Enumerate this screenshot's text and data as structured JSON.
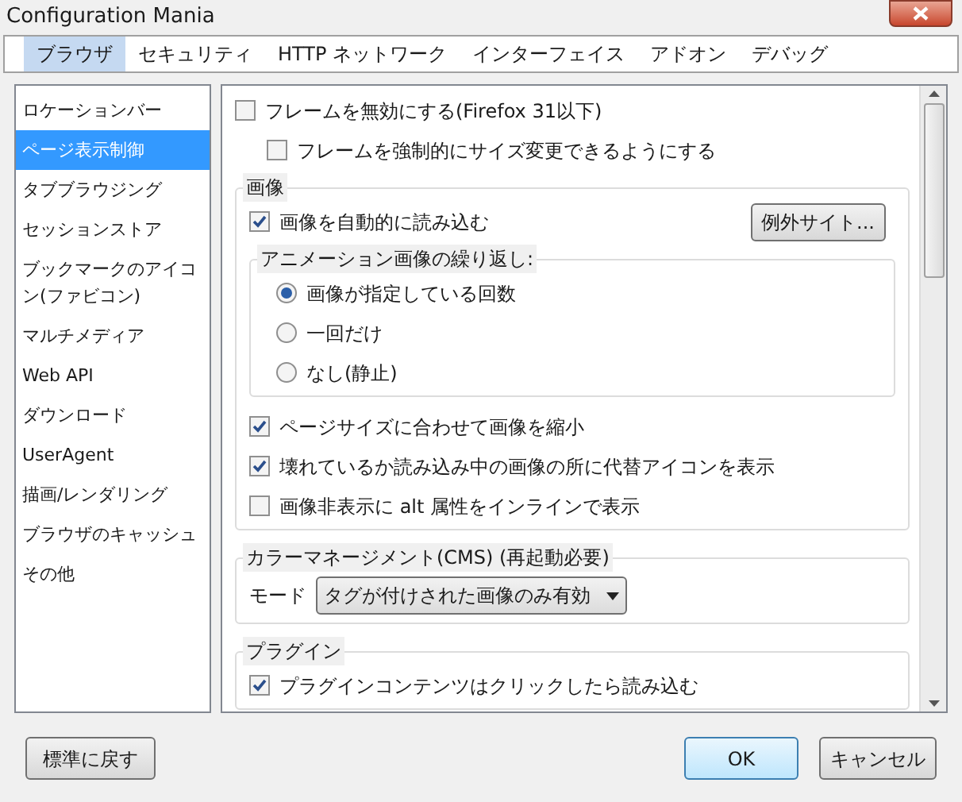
{
  "window": {
    "title": "Configuration Mania"
  },
  "tabs": [
    {
      "label": "ブラウザ",
      "selected": true
    },
    {
      "label": "セキュリティ",
      "selected": false
    },
    {
      "label": "HTTP ネットワーク",
      "selected": false
    },
    {
      "label": "インターフェイス",
      "selected": false
    },
    {
      "label": "アドオン",
      "selected": false
    },
    {
      "label": "デバッグ",
      "selected": false
    }
  ],
  "sidebar": {
    "items": [
      {
        "label": "ロケーションバー",
        "selected": false
      },
      {
        "label": "ページ表示制御",
        "selected": true
      },
      {
        "label": "タブブラウジング",
        "selected": false
      },
      {
        "label": "セッションストア",
        "selected": false
      },
      {
        "label": "ブックマークのアイコン(ファビコン)",
        "selected": false
      },
      {
        "label": "マルチメディア",
        "selected": false
      },
      {
        "label": "Web API",
        "selected": false
      },
      {
        "label": "ダウンロード",
        "selected": false
      },
      {
        "label": "UserAgent",
        "selected": false
      },
      {
        "label": "描画/レンダリング",
        "selected": false
      },
      {
        "label": "ブラウザのキャッシュ",
        "selected": false
      },
      {
        "label": "その他",
        "selected": false
      }
    ]
  },
  "content": {
    "items": [
      {
        "kind": "checkbox",
        "label": "フレームを無効にする(Firefox 31以下)",
        "checked": false,
        "children": [
          {
            "kind": "checkbox",
            "label": "フレームを強制的にサイズ変更できるようにする",
            "checked": false
          }
        ]
      },
      {
        "kind": "group",
        "title": "画像",
        "items": [
          {
            "kind": "checkbox",
            "label": "画像を自動的に読み込む",
            "checked": true,
            "button": "例外サイト..."
          },
          {
            "kind": "group",
            "title": "アニメーション画像の繰り返し:",
            "items": [
              {
                "kind": "radio",
                "label": "画像が指定している回数",
                "selected": true
              },
              {
                "kind": "radio",
                "label": "一回だけ",
                "selected": false
              },
              {
                "kind": "radio",
                "label": "なし(静止)",
                "selected": false
              }
            ]
          },
          {
            "kind": "checkbox",
            "label": "ページサイズに合わせて画像を縮小",
            "checked": true
          },
          {
            "kind": "checkbox",
            "label": "壊れているか読み込み中の画像の所に代替アイコンを表示",
            "checked": true
          },
          {
            "kind": "checkbox",
            "label": "画像非表示に alt 属性をインラインで表示",
            "checked": false
          }
        ]
      },
      {
        "kind": "group",
        "title": "カラーマネージメント(CMS) (再起動必要)",
        "items": [
          {
            "kind": "select",
            "label": "モード",
            "value": "タグが付けされた画像のみ有効"
          }
        ]
      },
      {
        "kind": "group",
        "title": "プラグイン",
        "items": [
          {
            "kind": "checkbox",
            "label": "プラグインコンテンツはクリックしたら読み込む",
            "checked": true
          }
        ]
      }
    ]
  },
  "footer": {
    "reset_button": "標準に戻す",
    "ok_button": "OK",
    "cancel_button": "キャンセル"
  }
}
